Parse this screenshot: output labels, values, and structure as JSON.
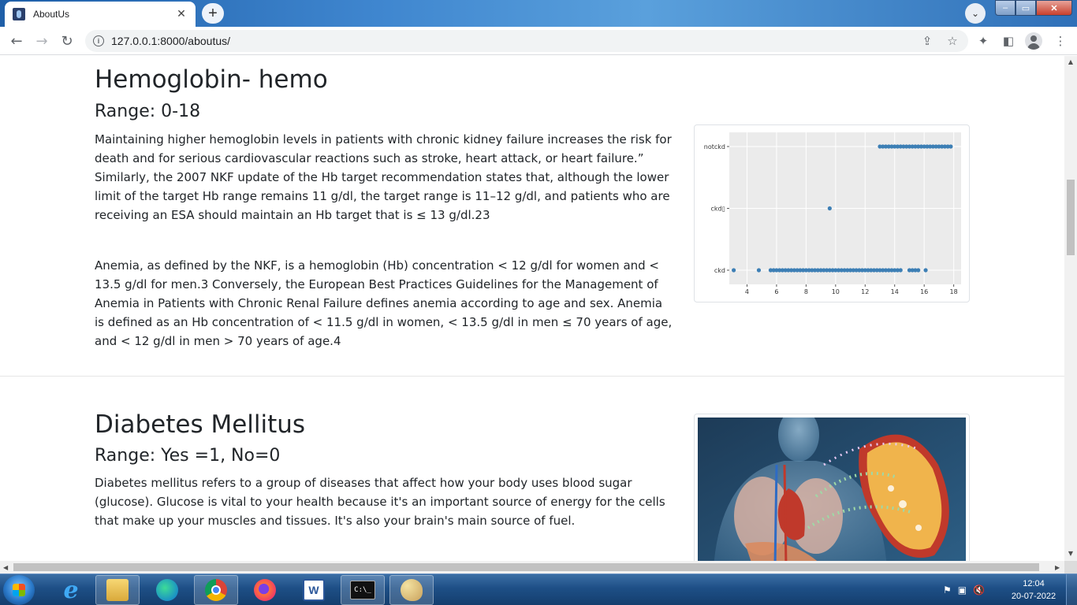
{
  "browser": {
    "tab_title": "AboutUs",
    "tab_close": "✕",
    "new_tab": "+",
    "url": "127.0.0.1:8000/aboutus/",
    "info": "i"
  },
  "section1": {
    "title": "Hemoglobin- hemo",
    "range": "Range: 0-18",
    "para1": "Maintaining higher hemoglobin levels in patients with chronic kidney failure increases the risk for death and for serious cardiovascular reactions such as stroke, heart attack, or heart failure.” Similarly, the 2007 NKF update of the Hb target recommendation states that, although the lower limit of the target Hb range remains 11 g/dl, the target range is 11–12 g/dl, and patients who are receiving an ESA should maintain an Hb target that is ≤ 13 g/dl.23",
    "para2": "Anemia, as defined by the NKF, is a hemoglobin (Hb) concentration < 12 g/dl for women and < 13.5 g/dl for men.3 Conversely, the European Best Practices Guidelines for the Management of Anemia in Patients with Chronic Renal Failure defines anemia according to age and sex. Anemia is defined as an Hb concentration of < 11.5 g/dl in women, < 13.5 g/dl in men ≤ 70 years of age, and < 12 g/dl in men > 70 years of age.4"
  },
  "section2": {
    "title": "Diabetes Mellitus",
    "range": "Range: Yes =1, No=0",
    "para1": "Diabetes mellitus refers to a group of diseases that affect how your body uses blood sugar (glucose). Glucose is vital to your health because it's an important source of energy for the cells that make up your muscles and tissues. It's also your brain's main source of fuel."
  },
  "chart_data": {
    "type": "scatter",
    "title": "",
    "xlabel": "",
    "ylabel": "",
    "xlim": [
      2.8,
      18.5
    ],
    "x_ticks": [
      4,
      6,
      8,
      10,
      12,
      14,
      16,
      18
    ],
    "categories": [
      "ckd",
      "ckd\t",
      "notckd"
    ],
    "category_labels": [
      "ckd",
      "ckd▯",
      "notckd"
    ],
    "grid": true,
    "color": "#3d7fb5",
    "series": [
      {
        "category": "notckd",
        "x": [
          13.0,
          13.2,
          13.4,
          13.6,
          13.8,
          14.0,
          14.2,
          14.4,
          14.6,
          14.8,
          15.0,
          15.2,
          15.4,
          15.6,
          15.8,
          16.0,
          16.2,
          16.4,
          16.6,
          16.8,
          17.0,
          17.2,
          17.4,
          17.6,
          17.8
        ]
      },
      {
        "category": "ckd\t",
        "x": [
          9.6
        ]
      },
      {
        "category": "ckd",
        "x": [
          3.1,
          4.8,
          5.6,
          5.8,
          6.0,
          6.2,
          6.4,
          6.6,
          6.8,
          7.0,
          7.2,
          7.4,
          7.6,
          7.8,
          8.0,
          8.2,
          8.4,
          8.6,
          8.8,
          9.0,
          9.2,
          9.4,
          9.6,
          9.8,
          10.0,
          10.2,
          10.4,
          10.6,
          10.8,
          11.0,
          11.2,
          11.4,
          11.6,
          11.8,
          12.0,
          12.2,
          12.4,
          12.6,
          12.8,
          13.0,
          13.2,
          13.4,
          13.6,
          13.8,
          14.0,
          14.2,
          14.4,
          15.0,
          15.2,
          15.4,
          15.6,
          16.1
        ]
      }
    ]
  },
  "taskbar": {
    "time": "12:04",
    "date": "20-07-2022",
    "apps": [
      "internet-explorer",
      "file-explorer",
      "edge",
      "chrome",
      "firefox",
      "word",
      "command-prompt",
      "paint"
    ],
    "word_label": "W",
    "cmd_label": "C:\\_"
  }
}
